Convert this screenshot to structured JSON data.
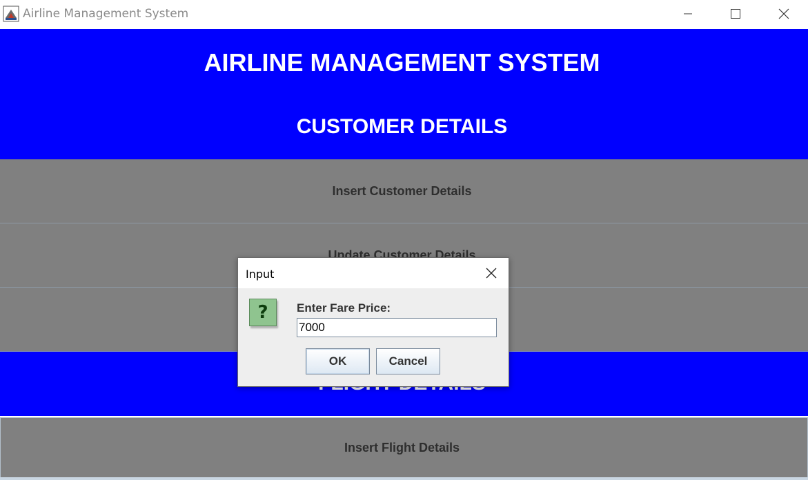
{
  "window": {
    "title": "Airline Management System",
    "icons": {
      "app": "java-cup-icon",
      "minimize": "minimize-icon",
      "maximize": "maximize-icon",
      "close": "close-icon"
    }
  },
  "header": {
    "app_heading": "AIRLINE MANAGEMENT SYSTEM",
    "customer_section": "CUSTOMER DETAILS"
  },
  "customer_buttons": [
    {
      "label": "Insert Customer Details"
    },
    {
      "label": "Update Customer Details"
    },
    {
      "label": ""
    }
  ],
  "flight": {
    "section": "FLIGHT DETAILS",
    "insert_label": "Insert Flight Details"
  },
  "dialog": {
    "title": "Input",
    "prompt": "Enter Fare Price:",
    "input_value": "7000",
    "ok_label": "OK",
    "cancel_label": "Cancel",
    "icon": "question-icon",
    "icon_glyph": "?"
  },
  "colors": {
    "accent_blue": "#0000ff",
    "button_gray": "#808080",
    "title_text": "#8a8a8a"
  }
}
